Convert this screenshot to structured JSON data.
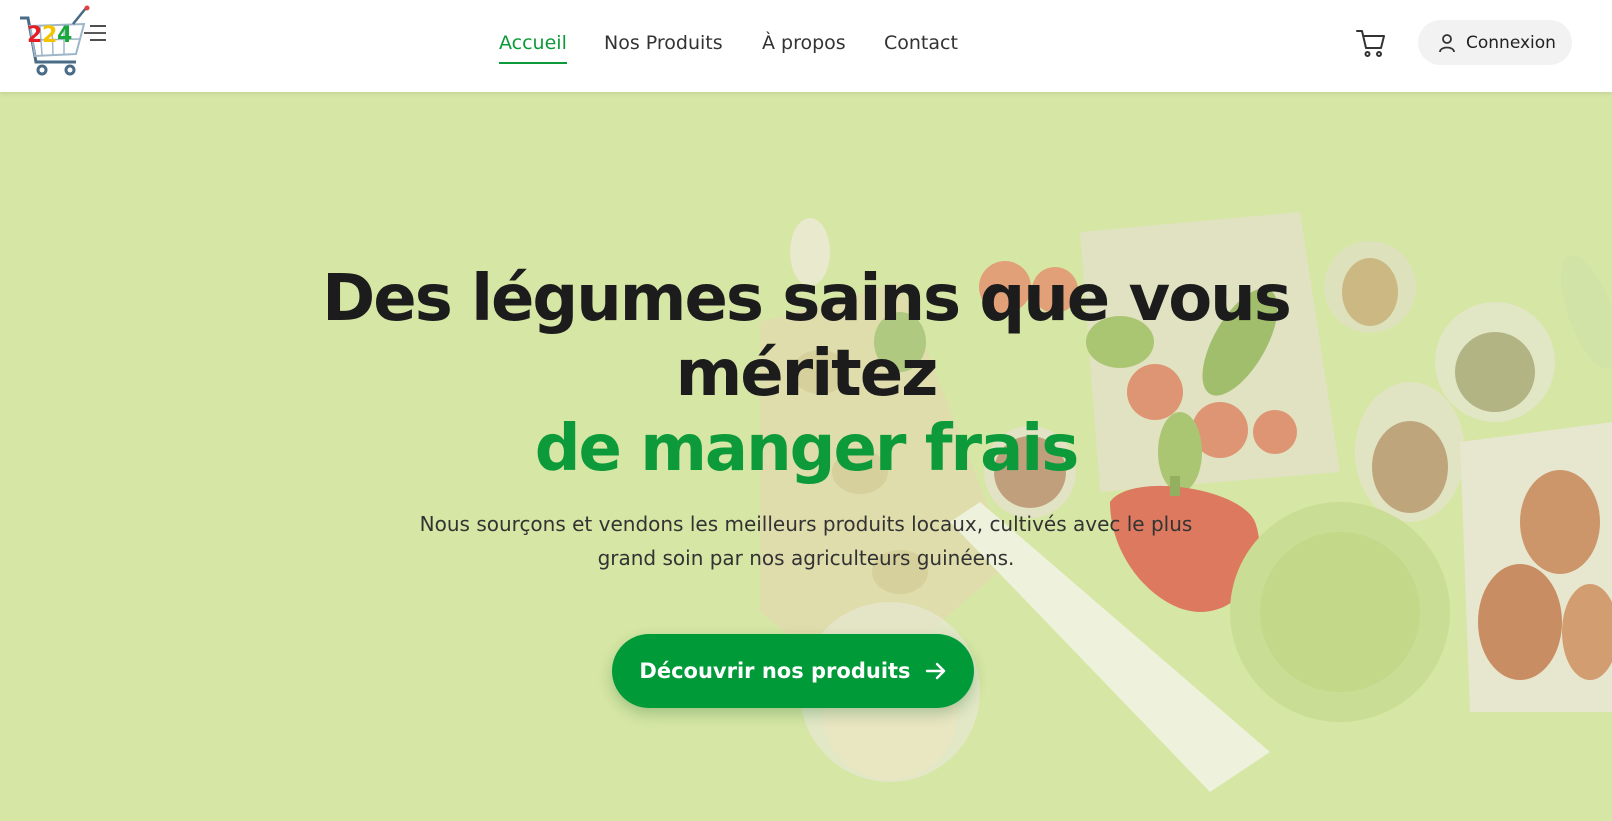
{
  "header": {
    "logo": {
      "text": "224",
      "icon": "shopping-cart-logo"
    },
    "nav": [
      {
        "label": "Accueil",
        "active": true
      },
      {
        "label": "Nos Produits",
        "active": false
      },
      {
        "label": "À propos",
        "active": false
      },
      {
        "label": "Contact",
        "active": false
      }
    ],
    "cart_icon": "cart-icon",
    "login_label": "Connexion",
    "login_icon": "user-icon"
  },
  "hero": {
    "headline_line1": "Des légumes sains que vous",
    "headline_line2": "méritez",
    "headline_accent": "de manger frais",
    "subtitle": "Nous sourçons et vendons les meilleurs produits locaux, cultivés avec le plus grand soin par nos agriculteurs guinéens.",
    "cta_label": "Découvrir nos produits",
    "cta_icon": "arrow-right-icon"
  },
  "colors": {
    "accent": "#0d9a3a",
    "cta": "#009b38",
    "hero_bg": "#d6e6a4",
    "text_dark": "#1c1c1c"
  }
}
